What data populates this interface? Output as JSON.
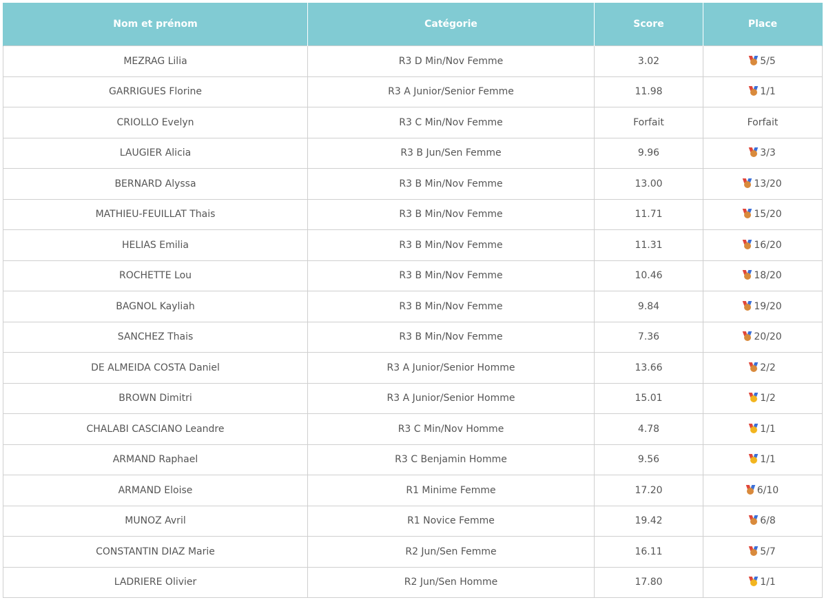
{
  "table": {
    "headers": {
      "name": "Nom et prénom",
      "category": "Catégorie",
      "score": "Score",
      "place": "Place"
    },
    "rows": [
      {
        "name": "MEZRAG Lilia",
        "category": "R3 D Min/Nov Femme",
        "score": "3.02",
        "place": "5/5",
        "medal": "bronze"
      },
      {
        "name": "GARRIGUES Florine",
        "category": "R3 A Junior/Senior Femme",
        "score": "11.98",
        "place": "1/1",
        "medal": "bronze"
      },
      {
        "name": "CRIOLLO Evelyn",
        "category": "R3 C Min/Nov Femme",
        "score": "Forfait",
        "place": "Forfait",
        "medal": "none"
      },
      {
        "name": "LAUGIER Alicia",
        "category": "R3 B Jun/Sen Femme",
        "score": "9.96",
        "place": "3/3",
        "medal": "bronze"
      },
      {
        "name": "BERNARD Alyssa",
        "category": "R3 B Min/Nov Femme",
        "score": "13.00",
        "place": "13/20",
        "medal": "bronze"
      },
      {
        "name": "MATHIEU-FEUILLAT Thais",
        "category": "R3 B Min/Nov Femme",
        "score": "11.71",
        "place": "15/20",
        "medal": "bronze"
      },
      {
        "name": "HELIAS Emilia",
        "category": "R3 B Min/Nov Femme",
        "score": "11.31",
        "place": "16/20",
        "medal": "bronze"
      },
      {
        "name": "ROCHETTE Lou",
        "category": "R3 B Min/Nov Femme",
        "score": "10.46",
        "place": "18/20",
        "medal": "bronze"
      },
      {
        "name": "BAGNOL Kayliah",
        "category": "R3 B Min/Nov Femme",
        "score": "9.84",
        "place": "19/20",
        "medal": "bronze"
      },
      {
        "name": "SANCHEZ Thais",
        "category": "R3 B Min/Nov Femme",
        "score": "7.36",
        "place": "20/20",
        "medal": "bronze"
      },
      {
        "name": "DE ALMEIDA COSTA Daniel",
        "category": "R3 A Junior/Senior Homme",
        "score": "13.66",
        "place": "2/2",
        "medal": "bronze"
      },
      {
        "name": "BROWN Dimitri",
        "category": "R3 A Junior/Senior Homme",
        "score": "15.01",
        "place": "1/2",
        "medal": "gold"
      },
      {
        "name": "CHALABI CASCIANO Leandre",
        "category": "R3 C Min/Nov Homme",
        "score": "4.78",
        "place": "1/1",
        "medal": "gold"
      },
      {
        "name": "ARMAND Raphael",
        "category": "R3 C Benjamin Homme",
        "score": "9.56",
        "place": "1/1",
        "medal": "gold"
      },
      {
        "name": "ARMAND Eloise",
        "category": "R1 Minime Femme",
        "score": "17.20",
        "place": "6/10",
        "medal": "bronze"
      },
      {
        "name": "MUNOZ Avril",
        "category": "R1 Novice Femme",
        "score": "19.42",
        "place": "6/8",
        "medal": "bronze"
      },
      {
        "name": "CONSTANTIN DIAZ Marie",
        "category": "R2 Jun/Sen Femme",
        "score": "16.11",
        "place": "5/7",
        "medal": "bronze"
      },
      {
        "name": "LADRIERE Olivier",
        "category": "R2 Jun/Sen Homme",
        "score": "17.80",
        "place": "1/1",
        "medal": "gold"
      }
    ]
  },
  "colors": {
    "header_bg": "#81cbd3",
    "header_text": "#ffffff",
    "cell_text": "#555555",
    "border": "#cfcfcf",
    "medal_bronze": "#d98a3c",
    "medal_gold": "#f2b51f",
    "ribbon_red": "#e0463a",
    "ribbon_blue": "#3a6fd8"
  },
  "icons": {
    "bronze": "bronze-medal-icon",
    "gold": "gold-medal-icon"
  }
}
